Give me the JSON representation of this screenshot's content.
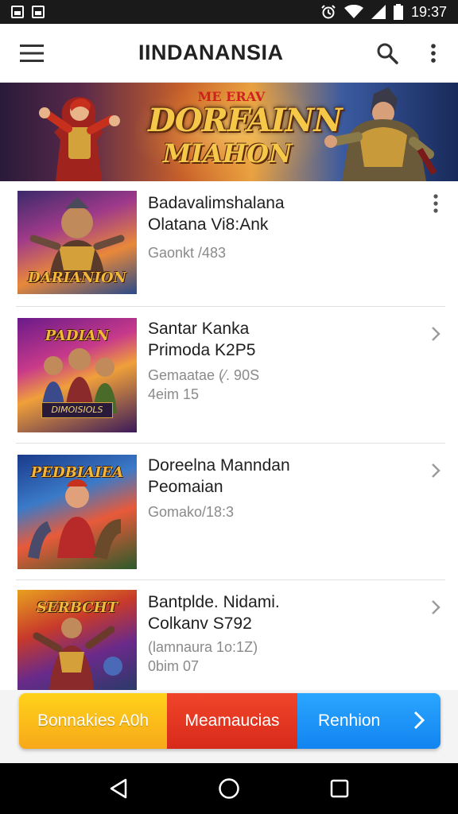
{
  "status_bar": {
    "time": "19:37",
    "icons": [
      "notification-icon",
      "image-icon",
      "alarm-icon",
      "wifi-icon",
      "signal-icon",
      "battery-icon"
    ]
  },
  "app_bar": {
    "title": "IINDANANSIA",
    "menu_icon": "hamburger-menu-icon",
    "search_icon": "search-icon",
    "more_icon": "more-vert-icon"
  },
  "banner": {
    "tag": "ME ERAV",
    "title_line1": "DORFAINN",
    "title_line2": "MIAHON"
  },
  "list": {
    "items": [
      {
        "title_line1": "Badavalimshalana",
        "title_line2": "Olatana Vi8:Ank",
        "meta_line1": "Gaonkt /483",
        "meta_line2": "",
        "thumb_label": "DARIANION",
        "action_icon": "more-vert-icon"
      },
      {
        "title_line1": "Santar Kanka",
        "title_line2": "Primoda K2P5",
        "meta_line1": "Gemaatae (⁄. 90S",
        "meta_line2": "4eim 15",
        "thumb_label": "PADIAN",
        "thumb_sublabel": "DIMOISIOLS",
        "action_icon": "chevron-right-icon"
      },
      {
        "title_line1": "Doreelna Manndan",
        "title_line2": "Peomaian",
        "meta_line1": "Gomako/18:3",
        "meta_line2": "",
        "thumb_label": "PEDBIAIEA",
        "action_icon": "chevron-right-icon"
      },
      {
        "title_line1": "Bantplde. Nidami.",
        "title_line2": "Colkanv S792",
        "meta_line1": "(lamnaura 1o:1Z)",
        "meta_line2": "0bim 07",
        "thumb_label": "SERBCHT",
        "action_icon": "chevron-right-icon"
      }
    ]
  },
  "actions": {
    "yellow_label": "Bonnakies A0h",
    "red_label": "Meamaucias",
    "blue_label": "Renhion",
    "colors": {
      "yellow": "#f7b81a",
      "red": "#e03a22",
      "blue": "#1a94f8"
    }
  },
  "nav_bar": {
    "back_icon": "back-triangle-icon",
    "home_icon": "home-circle-icon",
    "recents_icon": "recents-square-icon"
  }
}
